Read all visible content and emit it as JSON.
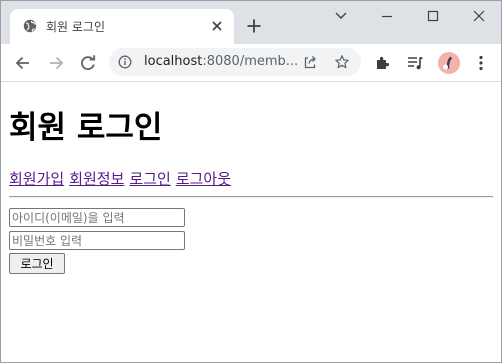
{
  "tab": {
    "title": "회원 로그인"
  },
  "toolbar": {
    "url_host": "localhost",
    "url_rest": ":8080/memb..."
  },
  "page": {
    "title": "회원 로그인",
    "nav": [
      {
        "label": "회원가입"
      },
      {
        "label": "회원정보"
      },
      {
        "label": "로그인"
      },
      {
        "label": "로그아웃"
      }
    ],
    "form": {
      "email_placeholder": "아이디(이메일)을 입력",
      "password_placeholder": "비밀번호 입력",
      "submit_label": "로그인"
    }
  },
  "icons": {
    "tab_favicon": "globe-icon",
    "tab_close": "close-icon",
    "new_tab": "plus-icon",
    "back": "arrow-left-icon",
    "forward": "arrow-right-icon",
    "reload": "reload-icon",
    "site_info": "info-icon",
    "share": "share-icon",
    "bookmark": "star-icon",
    "extensions": "puzzle-icon",
    "media": "media-queue-icon",
    "profile": "avatar",
    "menu": "kebab-menu-icon"
  },
  "colors": {
    "titlebar_bg": "#dee1e6",
    "omnibox_bg": "#f1f3f4",
    "visited_link": "#551a8b",
    "forward_disabled": "#b0b3b8"
  }
}
